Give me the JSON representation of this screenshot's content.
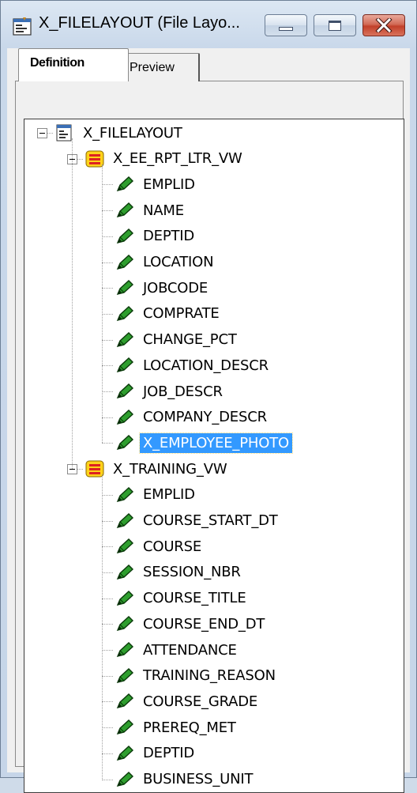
{
  "window": {
    "title": "X_FILELAYOUT (File Layo...",
    "title_icon": "file-layout-icon",
    "buttons": [
      "minimize",
      "maximize",
      "close"
    ],
    "close_color": "#c2402a"
  },
  "tabs": [
    {
      "label": "Definition",
      "active": true
    },
    {
      "label": "Preview",
      "active": false
    }
  ],
  "tree": {
    "root": {
      "label": "X_FILELAYOUT",
      "icon": "file-layout-icon",
      "expanded": true
    },
    "records": [
      {
        "label": "X_EE_RPT_LTR_VW",
        "icon": "record-icon",
        "expanded": true,
        "fields": [
          "EMPLID",
          "NAME",
          "DEPTID",
          "LOCATION",
          "JOBCODE",
          "COMPRATE",
          "CHANGE_PCT",
          "LOCATION_DESCR",
          "JOB_DESCR",
          "COMPANY_DESCR",
          "X_EMPLOYEE_PHOTO"
        ]
      },
      {
        "label": "X_TRAINING_VW",
        "icon": "record-icon",
        "expanded": true,
        "fields": [
          "EMPLID",
          "COURSE_START_DT",
          "COURSE",
          "SESSION_NBR",
          "COURSE_TITLE",
          "COURSE_END_DT",
          "ATTENDANCE",
          "TRAINING_REASON",
          "COURSE_GRADE",
          "PREREQ_MET",
          "DEPTID",
          "BUSINESS_UNIT"
        ]
      }
    ],
    "selected": "X_EMPLOYEE_PHOTO",
    "field_icon": "field-pencil-icon",
    "selection_color": "#3399ff"
  }
}
